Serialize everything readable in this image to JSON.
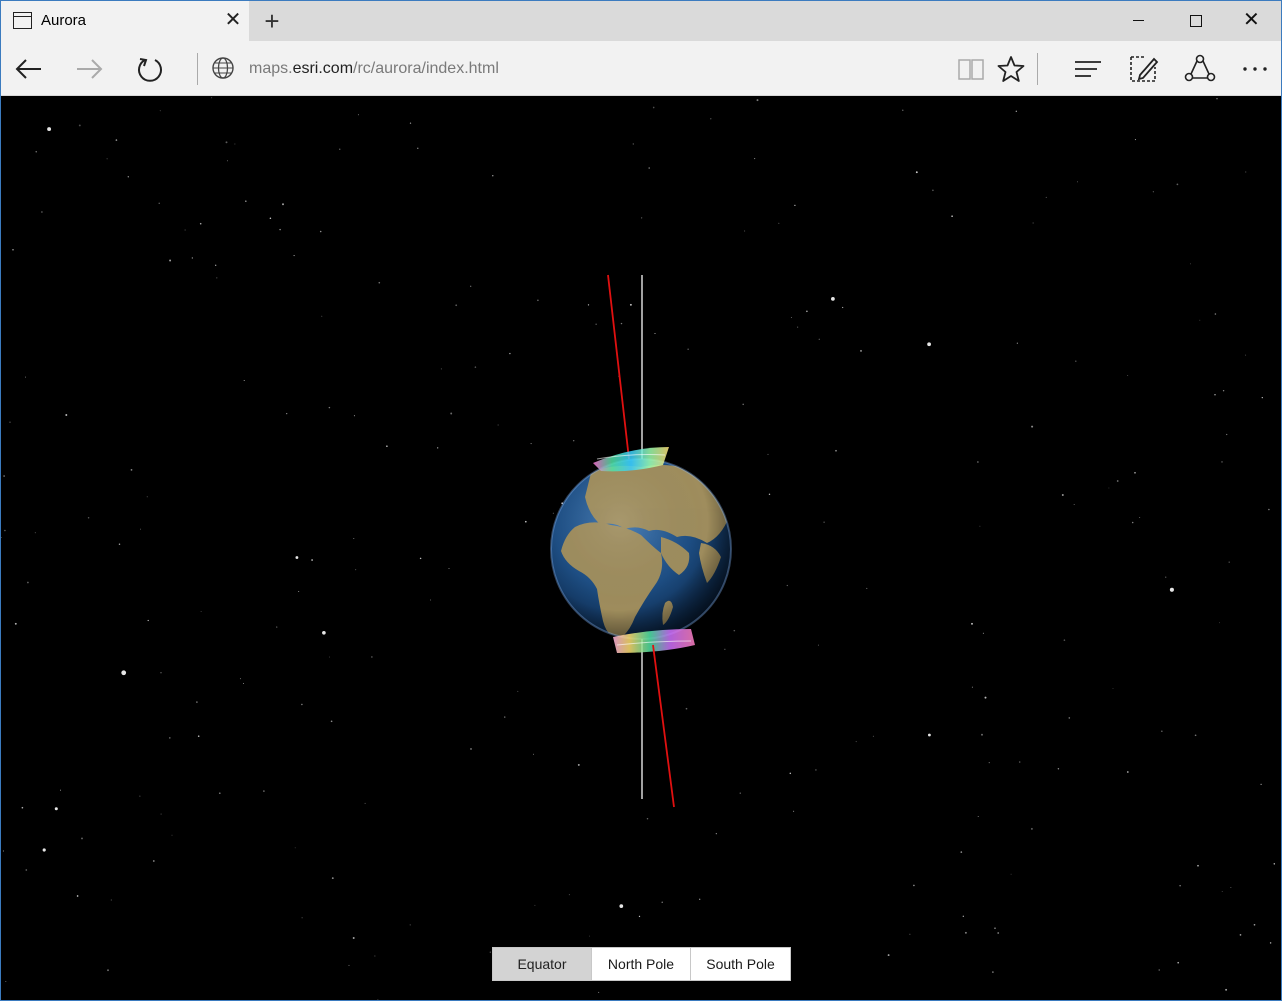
{
  "browser": {
    "tab_title": "Aurora",
    "url_prefix": "maps.",
    "url_host": "esri.com",
    "url_path": "/rc/aurora/index.html"
  },
  "viewbar": {
    "buttons": [
      {
        "label": "Equator",
        "active": true
      },
      {
        "label": "North Pole",
        "active": false
      },
      {
        "label": "South Pole",
        "active": false
      }
    ]
  },
  "colors": {
    "space": "#000000",
    "rotation_axis": "#e6e6e6",
    "magnetic_axis": "#e01010",
    "ocean": "#1d4e84",
    "land": "#a6915c",
    "active_button": "#d3d3d3"
  },
  "icons": [
    "tab-page-icon",
    "close-icon",
    "plus-icon",
    "minimize-icon",
    "maximize-icon",
    "back-arrow-icon",
    "forward-arrow-icon",
    "refresh-icon",
    "globe-icon",
    "reading-view-icon",
    "star-icon",
    "hub-icon",
    "web-note-icon",
    "share-icon",
    "more-icon"
  ]
}
